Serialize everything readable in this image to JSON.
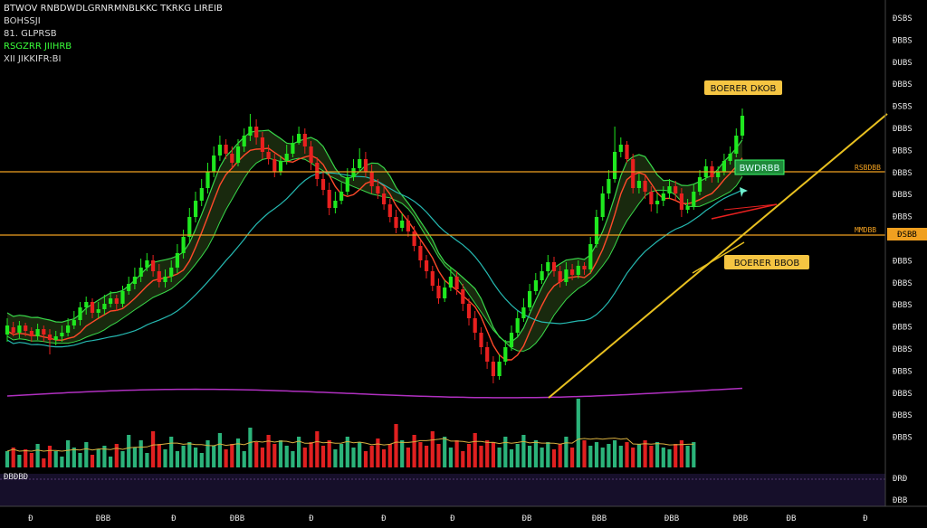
{
  "header": {
    "line1": "BTWOV RNBDWDLGRNRMNBLKKC TKRKG LIREIB",
    "line2": "BOHSSJI",
    "line3": "81. GLPRSB",
    "line4": "RSGZRR JIIHRB",
    "line5": "XII JIKKIFR:BI"
  },
  "colors": {
    "bull": "#1fe81f",
    "bear": "#e8201f",
    "vol_bull": "#2bb37a",
    "vol_bear": "#e02020",
    "ma_fast": "#ff4a2a",
    "ma_mid": "#39d94a",
    "ma_slow": "#25b8b0",
    "band_fill": "#2d4a1a",
    "level": "#f0a020",
    "trend": "#e8c020",
    "osc": "#b030c0",
    "tag_yellow": "#f5c542",
    "tag_green": "#1e8a3a",
    "sub_bg": "#160f2a"
  },
  "icons": {
    "arrow": "cursor-arrow-icon"
  },
  "chart_data": {
    "type": "candlestick",
    "y_ticks": [
      "ÐSBS",
      "ÐBBS",
      "ÐUBS",
      "ÐBBS",
      "ÐSBS",
      "ÐBBS",
      "ÐBBS",
      "ÐBBS",
      "ÐBBS",
      "ÐBBS",
      "ÐBBS",
      "ÐBBS",
      "ÐBBS",
      "ÐBBS",
      "ÐBBS",
      "ÐBBS",
      "ÐBBS",
      "ÐBBS",
      "ÐBBS",
      "ÐBBS"
    ],
    "x_ticks": [
      "Ð",
      "ÐBB",
      "Ð",
      "ÐBB",
      "Ð",
      "Ð",
      "Ð",
      "ÐB",
      "ÐBB",
      "ÐBB",
      "ÐBB",
      "ÐB",
      "Ð"
    ],
    "levels": [
      {
        "label": "RSBDBB",
        "price_tag": "ÐSBS"
      },
      {
        "label": "MMDBB",
        "price_tag": "ÐSBB"
      }
    ],
    "annotations": [
      {
        "text": "BOERER DKOB",
        "style": "yellow"
      },
      {
        "text": "BWDRBB",
        "style": "green"
      },
      {
        "text": "BOERER BBOB",
        "style": "yellow"
      }
    ],
    "sub_labels": {
      "left": "ÐBÐBÐ",
      "right_top": "ÐRÐ",
      "right_bottom": "ÐBB"
    },
    "candles": [
      [
        370,
        360,
        378,
        352
      ],
      [
        362,
        368,
        372,
        356
      ],
      [
        368,
        360,
        374,
        355
      ],
      [
        360,
        366,
        372,
        357
      ],
      [
        366,
        372,
        378,
        362
      ],
      [
        372,
        364,
        376,
        358
      ],
      [
        364,
        370,
        378,
        360
      ],
      [
        370,
        376,
        392,
        364
      ],
      [
        376,
        372,
        382,
        366
      ],
      [
        372,
        368,
        378,
        360
      ],
      [
        368,
        360,
        372,
        352
      ],
      [
        360,
        354,
        364,
        344
      ],
      [
        354,
        340,
        360,
        334
      ],
      [
        340,
        334,
        348,
        328
      ],
      [
        334,
        346,
        352,
        330
      ],
      [
        346,
        342,
        352,
        334
      ],
      [
        342,
        336,
        348,
        326
      ],
      [
        336,
        330,
        340,
        322
      ],
      [
        330,
        336,
        344,
        326
      ],
      [
        336,
        322,
        340,
        316
      ],
      [
        322,
        314,
        326,
        306
      ],
      [
        314,
        306,
        320,
        296
      ],
      [
        306,
        296,
        312,
        286
      ],
      [
        296,
        288,
        300,
        280
      ],
      [
        288,
        300,
        306,
        282
      ],
      [
        300,
        312,
        318,
        292
      ],
      [
        312,
        306,
        318,
        298
      ],
      [
        306,
        296,
        312,
        288
      ],
      [
        296,
        280,
        302,
        270
      ],
      [
        280,
        262,
        286,
        254
      ],
      [
        262,
        240,
        268,
        230
      ],
      [
        240,
        222,
        246,
        212
      ],
      [
        222,
        208,
        228,
        198
      ],
      [
        208,
        190,
        214,
        180
      ],
      [
        190,
        172,
        196,
        162
      ],
      [
        172,
        160,
        178,
        150
      ],
      [
        160,
        170,
        176,
        154
      ],
      [
        170,
        180,
        186,
        162
      ],
      [
        180,
        162,
        184,
        154
      ],
      [
        162,
        150,
        168,
        142
      ],
      [
        150,
        140,
        156,
        126
      ],
      [
        140,
        152,
        160,
        132
      ],
      [
        152,
        168,
        176,
        146
      ],
      [
        168,
        176,
        182,
        160
      ],
      [
        176,
        190,
        196,
        170
      ],
      [
        190,
        178,
        194,
        172
      ],
      [
        178,
        170,
        182,
        160
      ],
      [
        170,
        158,
        174,
        150
      ],
      [
        158,
        148,
        160,
        140
      ],
      [
        148,
        162,
        170,
        142
      ],
      [
        162,
        180,
        188,
        156
      ],
      [
        180,
        198,
        206,
        174
      ],
      [
        198,
        210,
        216,
        190
      ],
      [
        210,
        230,
        238,
        202
      ],
      [
        230,
        222,
        236,
        212
      ],
      [
        222,
        212,
        226,
        202
      ],
      [
        212,
        196,
        216,
        186
      ],
      [
        196,
        186,
        200,
        176
      ],
      [
        186,
        176,
        190,
        164
      ],
      [
        176,
        190,
        196,
        168
      ],
      [
        190,
        206,
        214,
        182
      ],
      [
        206,
        214,
        220,
        198
      ],
      [
        214,
        226,
        232,
        206
      ],
      [
        226,
        240,
        246,
        220
      ],
      [
        240,
        252,
        258,
        232
      ],
      [
        252,
        244,
        256,
        236
      ],
      [
        244,
        256,
        262,
        238
      ],
      [
        256,
        272,
        278,
        250
      ],
      [
        272,
        288,
        296,
        266
      ],
      [
        288,
        300,
        308,
        282
      ],
      [
        300,
        316,
        322,
        294
      ],
      [
        316,
        330,
        336,
        308
      ],
      [
        330,
        318,
        334,
        310
      ],
      [
        318,
        306,
        322,
        296
      ],
      [
        306,
        320,
        326,
        300
      ],
      [
        320,
        336,
        344,
        314
      ],
      [
        336,
        352,
        360,
        330
      ],
      [
        352,
        368,
        376,
        344
      ],
      [
        368,
        384,
        392,
        362
      ],
      [
        384,
        400,
        408,
        378
      ],
      [
        400,
        416,
        424,
        394
      ],
      [
        416,
        400,
        420,
        392
      ],
      [
        400,
        384,
        404,
        376
      ],
      [
        384,
        368,
        388,
        360
      ],
      [
        368,
        352,
        372,
        344
      ],
      [
        352,
        340,
        356,
        330
      ],
      [
        340,
        322,
        344,
        314
      ],
      [
        322,
        310,
        326,
        302
      ],
      [
        310,
        300,
        314,
        292
      ],
      [
        300,
        290,
        306,
        282
      ],
      [
        290,
        300,
        306,
        284
      ],
      [
        300,
        312,
        318,
        294
      ],
      [
        312,
        298,
        316,
        290
      ],
      [
        298,
        304,
        310,
        292
      ],
      [
        304,
        294,
        308,
        288
      ],
      [
        294,
        298,
        304,
        290
      ],
      [
        298,
        270,
        302,
        262
      ],
      [
        270,
        240,
        274,
        232
      ],
      [
        240,
        214,
        244,
        206
      ],
      [
        214,
        198,
        220,
        188
      ],
      [
        198,
        168,
        202,
        140
      ],
      [
        168,
        160,
        174,
        152
      ],
      [
        160,
        176,
        180,
        156
      ],
      [
        176,
        208,
        214,
        170
      ],
      [
        208,
        200,
        214,
        192
      ],
      [
        200,
        212,
        220,
        194
      ],
      [
        212,
        226,
        234,
        206
      ],
      [
        226,
        222,
        236,
        214
      ],
      [
        222,
        214,
        228,
        206
      ],
      [
        214,
        206,
        220,
        198
      ],
      [
        206,
        214,
        222,
        200
      ],
      [
        214,
        232,
        240,
        208
      ],
      [
        232,
        228,
        236,
        220
      ],
      [
        228,
        212,
        232,
        204
      ],
      [
        212,
        196,
        216,
        188
      ],
      [
        196,
        184,
        200,
        176
      ],
      [
        184,
        196,
        202,
        178
      ],
      [
        196,
        190,
        202,
        184
      ],
      [
        190,
        178,
        194,
        170
      ],
      [
        178,
        170,
        182,
        162
      ],
      [
        170,
        150,
        174,
        142
      ],
      [
        150,
        128,
        154,
        120
      ]
    ],
    "volume_values": [
      18,
      22,
      14,
      20,
      16,
      26,
      10,
      24,
      18,
      12,
      30,
      22,
      16,
      28,
      14,
      20,
      24,
      12,
      26,
      18,
      36,
      22,
      30,
      16,
      40,
      26,
      20,
      34,
      18,
      24,
      28,
      22,
      16,
      30,
      24,
      38,
      20,
      26,
      32,
      18,
      44,
      28,
      22,
      36,
      26,
      30,
      24,
      18,
      34,
      22,
      28,
      40,
      24,
      30,
      20,
      26,
      34,
      22,
      28,
      18,
      24,
      32,
      20,
      26,
      48,
      30,
      22,
      36,
      28,
      24,
      40,
      26,
      34,
      22,
      30,
      18,
      26,
      38,
      24,
      30,
      28,
      22,
      34,
      20,
      26,
      36,
      24,
      30,
      22,
      28,
      20,
      26,
      34,
      22,
      76,
      30,
      24,
      28,
      22,
      26,
      30,
      24,
      28,
      22,
      26,
      30,
      24,
      28,
      22,
      20,
      26,
      30,
      24,
      28
    ],
    "volume_ylim": [
      0,
      80
    ]
  }
}
